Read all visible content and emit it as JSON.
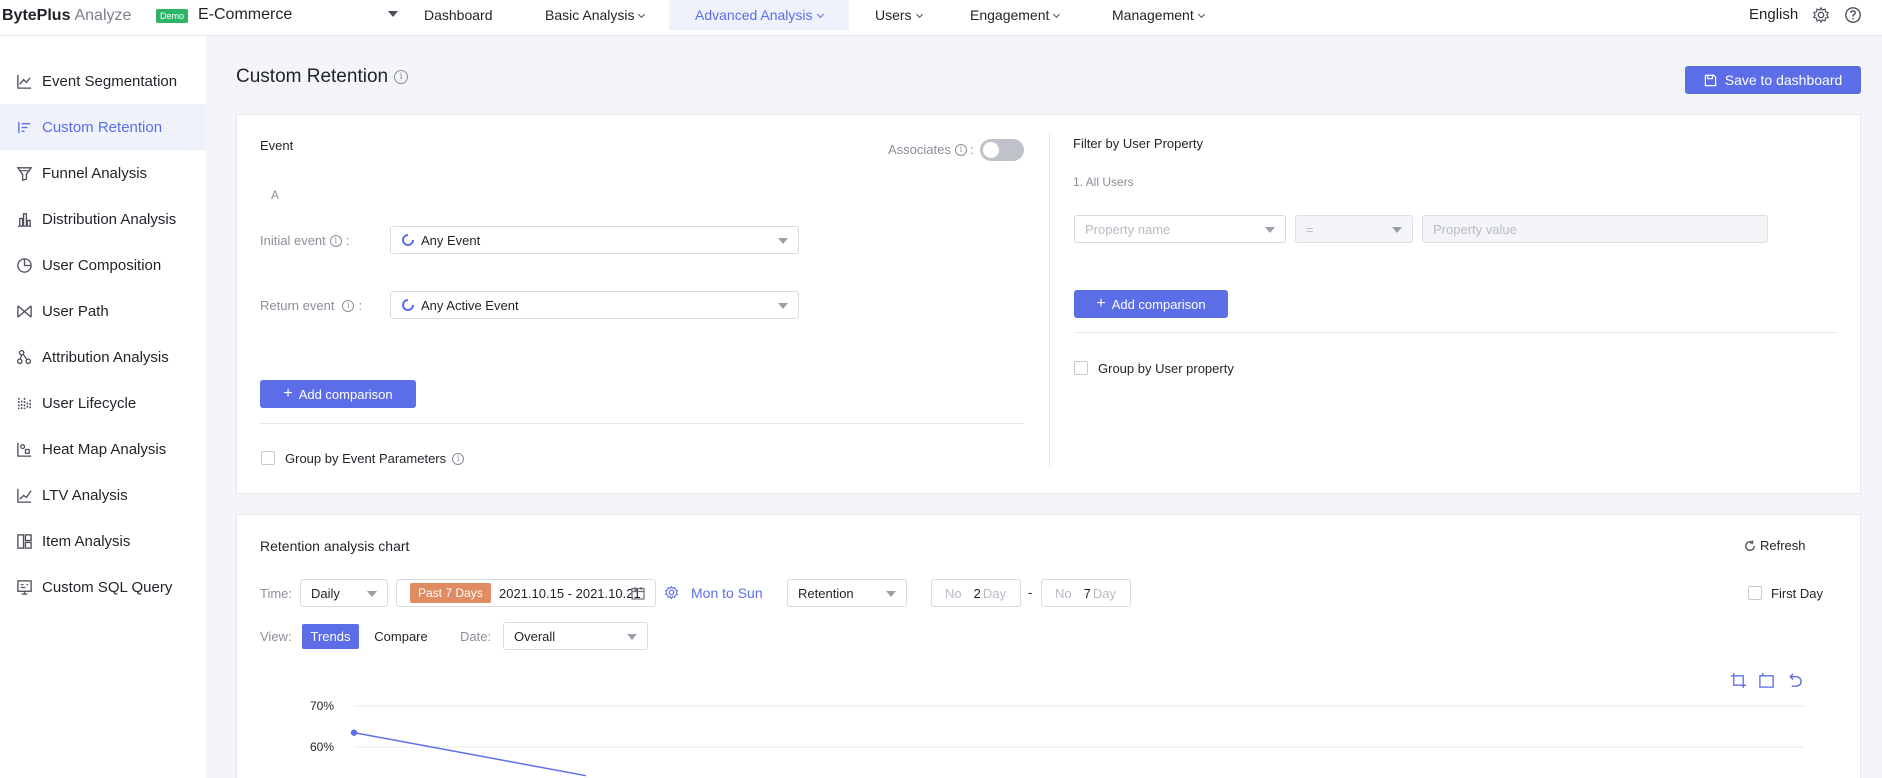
{
  "brand": {
    "name": "BytePlus",
    "sub": "Analyze"
  },
  "project": {
    "badge": "Demo",
    "name": "E-Commerce"
  },
  "nav": {
    "items": [
      {
        "label": "Dashboard"
      },
      {
        "label": "Basic Analysis"
      },
      {
        "label": "Advanced Analysis"
      },
      {
        "label": "Users"
      },
      {
        "label": "Engagement"
      },
      {
        "label": "Management"
      }
    ],
    "language": "English",
    "accent": "#5b6ee8"
  },
  "sidebar": {
    "items": [
      {
        "label": "Event Segmentation",
        "icon": "line-chart-icon"
      },
      {
        "label": "Custom Retention",
        "icon": "retention-icon"
      },
      {
        "label": "Funnel Analysis",
        "icon": "funnel-icon"
      },
      {
        "label": "Distribution Analysis",
        "icon": "bar-chart-icon"
      },
      {
        "label": "User Composition",
        "icon": "pie-chart-icon"
      },
      {
        "label": "User Path",
        "icon": "path-icon"
      },
      {
        "label": "Attribution Analysis",
        "icon": "attribution-icon"
      },
      {
        "label": "User Lifecycle",
        "icon": "lifecycle-icon"
      },
      {
        "label": "Heat Map Analysis",
        "icon": "heatmap-icon"
      },
      {
        "label": "LTV Analysis",
        "icon": "ltv-icon"
      },
      {
        "label": "Item Analysis",
        "icon": "item-icon"
      },
      {
        "label": "Custom SQL Query",
        "icon": "sql-icon"
      }
    ]
  },
  "page": {
    "title": "Custom Retention",
    "save_label": "Save to dashboard"
  },
  "event_panel": {
    "title": "Event",
    "associates_label": "Associates",
    "group_letter": "A",
    "initial_label": "Initial event",
    "initial_value": "Any Event",
    "return_label": "Return event",
    "return_value": "Any Active Event",
    "add_comparison": "Add comparison",
    "group_by_label": "Group by Event Parameters"
  },
  "filter_panel": {
    "title": "Filter by User Property",
    "all_users": "1. All Users",
    "property_name_placeholder": "Property name",
    "operator": "=",
    "property_value_placeholder": "Property value",
    "add_comparison": "Add comparison",
    "group_by_label": "Group by User property"
  },
  "chart_panel": {
    "title": "Retention analysis chart",
    "refresh": "Refresh",
    "time_label": "Time:",
    "granularity": "Daily",
    "past_tag": "Past 7 Days",
    "date_range": "2021.10.15 - 2021.10.21",
    "week_range": "Mon to Sun",
    "metric": "Retention",
    "no_label_1": "No",
    "day_from": "2",
    "day_label_1": "Day",
    "dash": "-",
    "no_label_2": "No",
    "day_to": "7",
    "day_label_2": "Day",
    "first_day": "First Day",
    "view_label": "View:",
    "view_trends": "Trends",
    "view_compare": "Compare",
    "date_label": "Date:",
    "date_value": "Overall"
  },
  "chart_data": {
    "type": "line",
    "y_ticks": [
      "70%",
      "60%"
    ],
    "y_tick_values": [
      70,
      60
    ],
    "series": [
      {
        "values": [
          63.5,
          53
        ]
      }
    ],
    "grid": true
  }
}
